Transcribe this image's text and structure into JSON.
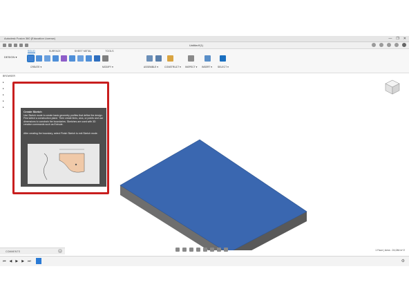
{
  "window": {
    "title": "Autodesk Fusion 360 (Education License)",
    "controls": [
      "—",
      "❐",
      "✕"
    ]
  },
  "document": {
    "title": "Untitled*(1)"
  },
  "ribbon": {
    "workspace": "DESIGN ▾",
    "tabs": [
      "SOLID",
      "SURFACE",
      "SHEET METAL",
      "TOOLS"
    ],
    "active_tab": "SOLID",
    "groups": [
      "CREATE ▾",
      "MODIFY ▾",
      "ASSEMBLE ▾",
      "CONSTRUCT ▾",
      "INSPECT ▾",
      "INSERT ▾",
      "SELECT ▾"
    ]
  },
  "browser": {
    "label": "BROWSER",
    "rows": [
      "▸",
      "▸",
      "▸",
      "▸",
      "▸"
    ]
  },
  "tooltip": {
    "title": "Create Sketch",
    "body": "Use Sketch mode to create basic geometry profiles that define the design. First select a construction plane. Then create lines, arcs, or points and use dimensions to constrain the boundaries. Sketches are used with 3D creation commands such as Extrude.",
    "body2": "After creating the boundary, select Finish Sketch to exit Sketch mode."
  },
  "comments": {
    "label": "COMMENTS",
    "add": "+"
  },
  "status": {
    "text": "1 Face | Area : 24,084 in^2"
  },
  "timeline": {
    "controls": [
      "⏮",
      "◀",
      "▶",
      "▶",
      "⏭"
    ],
    "settings": "⚙"
  },
  "colors": {
    "plate_top": "#3a67b0",
    "plate_side_left": "#6e6e6e",
    "plate_side_right": "#595959",
    "highlight": "#c81e1e",
    "accent": "#1a6fc0"
  }
}
